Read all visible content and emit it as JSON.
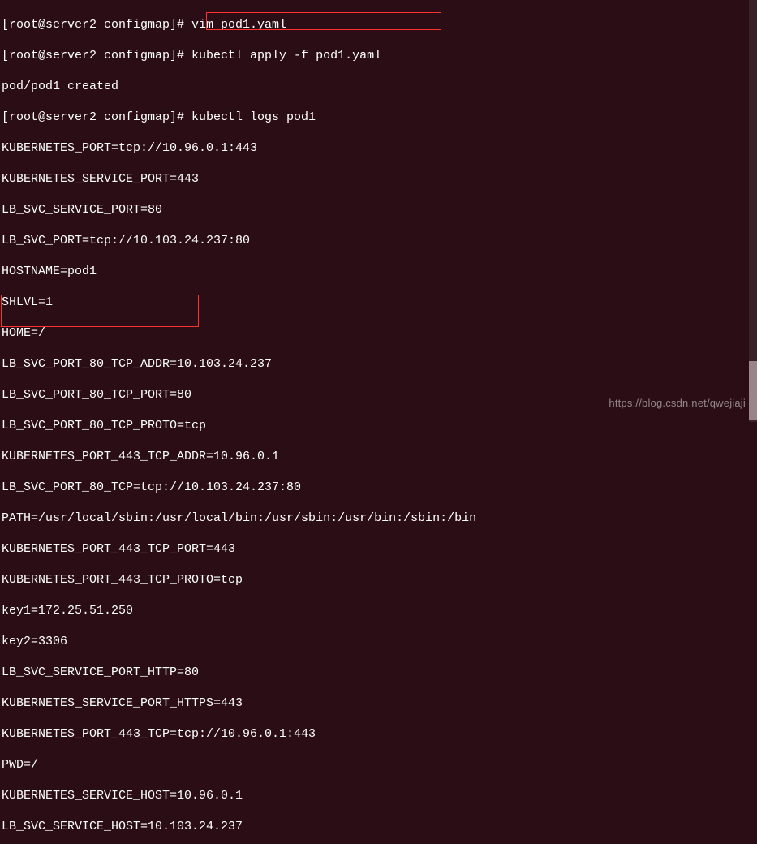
{
  "terminal": {
    "lines": [
      "[root@server2 configmap]# vim pod1.yaml",
      "[root@server2 configmap]# kubectl apply -f pod1.yaml",
      "pod/pod1 created",
      "[root@server2 configmap]# kubectl logs pod1",
      "KUBERNETES_PORT=tcp://10.96.0.1:443",
      "KUBERNETES_SERVICE_PORT=443",
      "LB_SVC_SERVICE_PORT=80",
      "LB_SVC_PORT=tcp://10.103.24.237:80",
      "HOSTNAME=pod1",
      "SHLVL=1",
      "HOME=/",
      "LB_SVC_PORT_80_TCP_ADDR=10.103.24.237",
      "LB_SVC_PORT_80_TCP_PORT=80",
      "LB_SVC_PORT_80_TCP_PROTO=tcp",
      "KUBERNETES_PORT_443_TCP_ADDR=10.96.0.1",
      "LB_SVC_PORT_80_TCP=tcp://10.103.24.237:80",
      "PATH=/usr/local/sbin:/usr/local/bin:/usr/sbin:/usr/bin:/sbin:/bin",
      "KUBERNETES_PORT_443_TCP_PORT=443",
      "KUBERNETES_PORT_443_TCP_PROTO=tcp",
      "key1=172.25.51.250",
      "key2=3306",
      "LB_SVC_SERVICE_PORT_HTTP=80",
      "KUBERNETES_SERVICE_PORT_HTTPS=443",
      "KUBERNETES_PORT_443_TCP=tcp://10.96.0.1:443",
      "PWD=/",
      "KUBERNETES_SERVICE_HOST=10.96.0.1",
      "LB_SVC_SERVICE_HOST=10.103.24.237"
    ]
  },
  "watermark": "https://blog.csdn.net/qwejiaji"
}
